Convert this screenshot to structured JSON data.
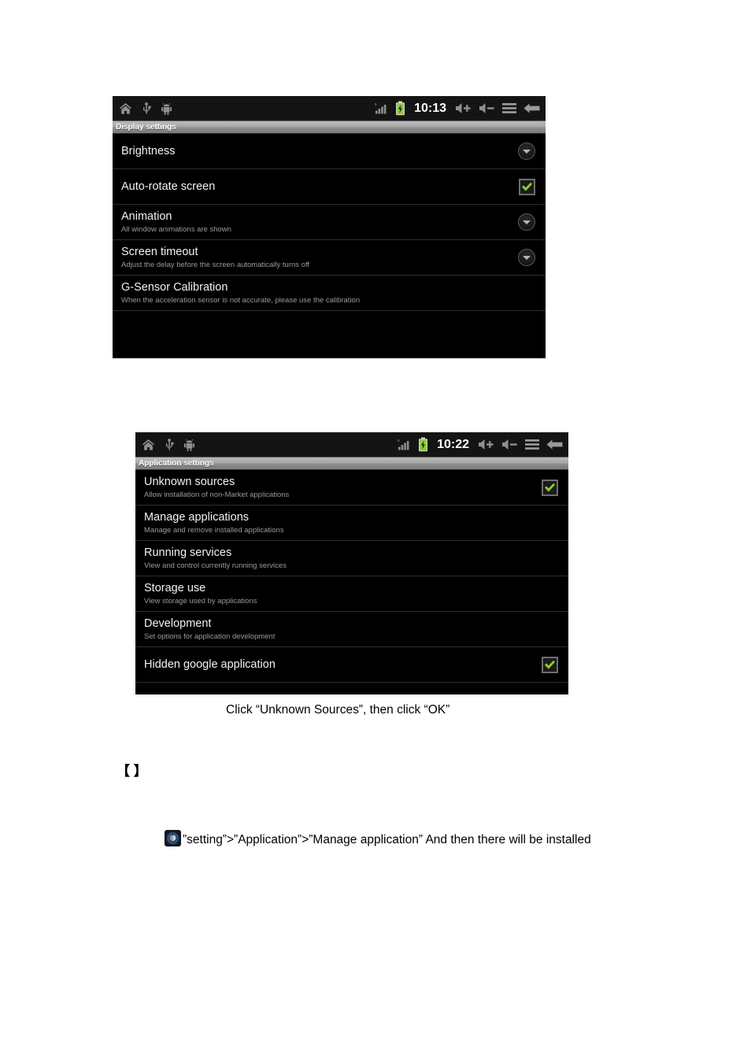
{
  "document": {
    "figure_caption": "Click “Unknown Sources”, then click “OK”",
    "bracket_line": "【          】",
    "install_path_line": "”setting”>”Application”>”Manage application” And then there will be installed",
    "settings_app_icon_name": "android-settings-app-icon"
  },
  "screenshots": [
    {
      "id": "display-settings",
      "status_bar": {
        "left_icons": [
          "home-icon",
          "usb-icon",
          "android-robot-icon"
        ],
        "right_icons": [
          "signal-bars-icon",
          "battery-charging-icon",
          "volume-up-icon",
          "volume-down-icon",
          "menu-icon",
          "back-arrow-icon"
        ],
        "clock": "10:13"
      },
      "title": "Display settings",
      "rows": [
        {
          "title": "Brightness",
          "summary": "",
          "widget": "disclosure",
          "checked": false
        },
        {
          "title": "Auto-rotate screen",
          "summary": "",
          "widget": "checkbox",
          "checked": true
        },
        {
          "title": "Animation",
          "summary": "All window animations are shown",
          "widget": "disclosure",
          "checked": false
        },
        {
          "title": "Screen timeout",
          "summary": "Adjust the delay before the screen automatically turns off",
          "widget": "disclosure",
          "checked": false
        },
        {
          "title": "G-Sensor Calibration",
          "summary": "When the acceleration sensor is not accurate, please use the calibration",
          "widget": "none",
          "checked": false
        }
      ]
    },
    {
      "id": "application-settings",
      "status_bar": {
        "left_icons": [
          "home-icon",
          "usb-icon",
          "android-robot-icon"
        ],
        "right_icons": [
          "signal-bars-icon",
          "battery-charging-icon",
          "volume-up-icon",
          "volume-down-icon",
          "menu-icon",
          "back-arrow-icon"
        ],
        "clock": "10:22"
      },
      "title": "Application settings",
      "rows": [
        {
          "title": "Unknown sources",
          "summary": "Allow installation of non-Market applications",
          "widget": "checkbox",
          "checked": true
        },
        {
          "title": "Manage applications",
          "summary": "Manage and remove installed applications",
          "widget": "none",
          "checked": false
        },
        {
          "title": "Running services",
          "summary": "View and control currently running services",
          "widget": "none",
          "checked": false
        },
        {
          "title": "Storage use",
          "summary": "View storage used by applications",
          "widget": "none",
          "checked": false
        },
        {
          "title": "Development",
          "summary": "Set options for application development",
          "widget": "none",
          "checked": false
        },
        {
          "title": "Hidden google application",
          "summary": "",
          "widget": "checkbox",
          "checked": true
        }
      ]
    }
  ],
  "colors": {
    "screen_background": "#000000",
    "title_bar": "#9a9a9a",
    "check_green": "#8ccf2a",
    "battery_green": "#8ccf2a",
    "row_title_text": "#f2f2f2",
    "row_summary_text": "#9a9a9a",
    "separator": "#2e2e2e"
  }
}
